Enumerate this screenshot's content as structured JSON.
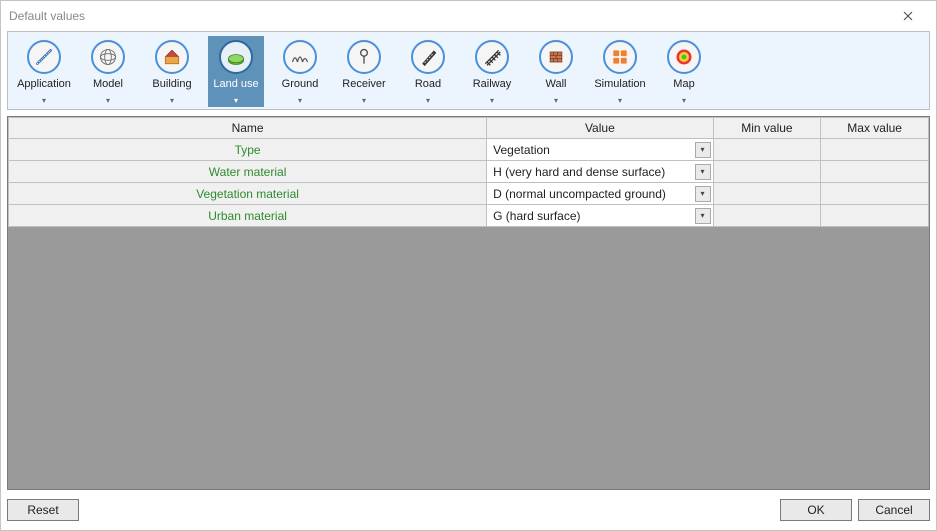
{
  "window": {
    "title": "Default values"
  },
  "toolbar": {
    "items": [
      {
        "label": "Application"
      },
      {
        "label": "Model"
      },
      {
        "label": "Building"
      },
      {
        "label": "Land use"
      },
      {
        "label": "Ground"
      },
      {
        "label": "Receiver"
      },
      {
        "label": "Road"
      },
      {
        "label": "Railway"
      },
      {
        "label": "Wall"
      },
      {
        "label": "Simulation"
      },
      {
        "label": "Map"
      }
    ],
    "selected_index": 3
  },
  "table": {
    "headers": {
      "name": "Name",
      "value": "Value",
      "min": "Min value",
      "max": "Max value"
    },
    "rows": [
      {
        "name": "Type",
        "value": "Vegetation"
      },
      {
        "name": "Water material",
        "value": "H (very hard and dense surface)"
      },
      {
        "name": "Vegetation material",
        "value": "D (normal uncompacted ground)"
      },
      {
        "name": "Urban material",
        "value": "G (hard surface)"
      }
    ]
  },
  "footer": {
    "reset": "Reset",
    "ok": "OK",
    "cancel": "Cancel"
  }
}
